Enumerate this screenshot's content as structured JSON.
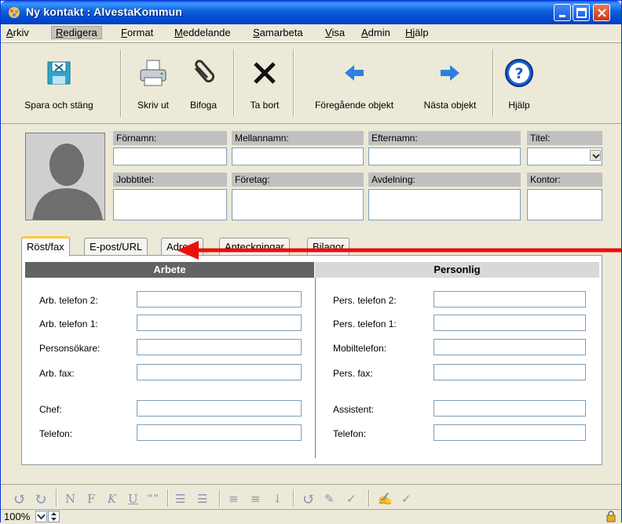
{
  "window": {
    "title": "Ny kontakt : AlvestaKommun",
    "accent": "#0a5fd8"
  },
  "menu": [
    {
      "label": "Arkiv",
      "u": "A"
    },
    {
      "label": "Redigera",
      "u": "R"
    },
    {
      "label": "Format",
      "u": "F"
    },
    {
      "label": "Meddelande",
      "u": "M"
    },
    {
      "label": "Samarbeta",
      "u": "S"
    },
    {
      "label": "Visa",
      "u": "V"
    },
    {
      "label": "Admin",
      "u": "A"
    },
    {
      "label": "Hjälp",
      "u": "H"
    }
  ],
  "toolbar": {
    "save_close": "Spara och stäng",
    "print": "Skriv ut",
    "attach": "Bifoga",
    "delete": "Ta bort",
    "previous": "Föregående objekt",
    "next": "Nästa objekt",
    "help": "Hjälp"
  },
  "fields": {
    "first_name": "Förnamn:",
    "middle_name": "Mellannamn:",
    "last_name": "Efternamn:",
    "title": "Titel:",
    "job_title": "Jobbtitel:",
    "company": "Företag:",
    "department": "Avdelning:",
    "office": "Kontor:"
  },
  "tabs": [
    "Röst/fax",
    "E-post/URL",
    "Adress",
    "Anteckningar",
    "Bilagor"
  ],
  "panel": {
    "work_header": "Arbete",
    "personal_header": "Personlig",
    "work": {
      "phone2": "Arb. telefon 2:",
      "phone1": "Arb. telefon 1:",
      "pager": "Personsökare:",
      "fax": "Arb. fax:",
      "manager": "Chef:",
      "manager_phone": "Telefon:"
    },
    "personal": {
      "phone2": "Pers. telefon 2:",
      "phone1": "Pers. telefon 1:",
      "mobile": "Mobiltelefon:",
      "fax": "Pers. fax:",
      "assistant": "Assistent:",
      "assistant_phone": "Telefon:"
    }
  },
  "status": {
    "zoom": "100%"
  },
  "annotation": {
    "arrow_color": "#e8100e"
  }
}
